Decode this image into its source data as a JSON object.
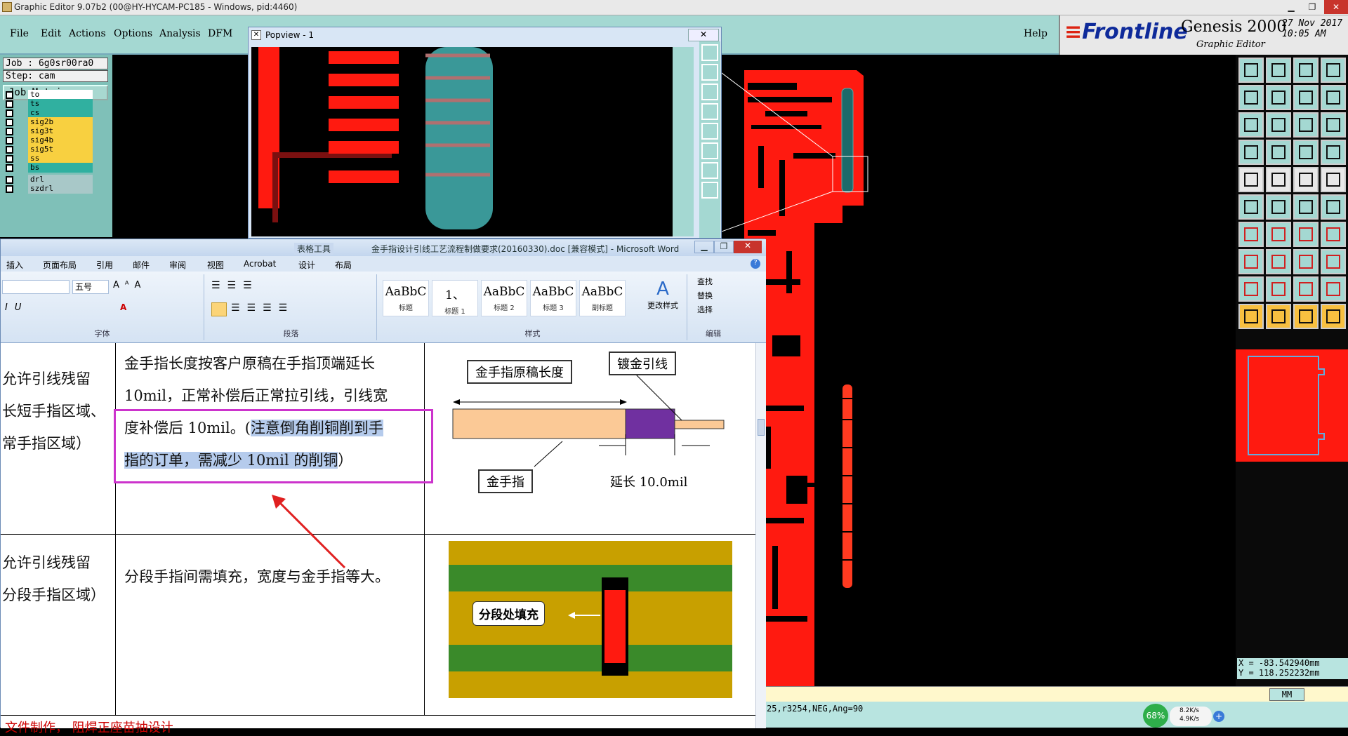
{
  "window": {
    "title": "Graphic Editor 9.07b2 (00@HY-HYCAM-PC185 - Windows, pid:4460)"
  },
  "menu": {
    "items": [
      "File",
      "Edit",
      "Actions",
      "Options",
      "Analysis",
      "DFM"
    ],
    "help": "Help"
  },
  "brand": {
    "logo": "Frontline",
    "product": "Genesis 2000",
    "subtitle": "Graphic Editor",
    "date": "27 Nov 2017",
    "time": "10:05 AM"
  },
  "job": {
    "job": "Job : 6g0sr00ra0",
    "step": "Step: cam",
    "matrix_button": "Job Matrix ..."
  },
  "layers": [
    {
      "name": "to",
      "color": "#ffffff"
    },
    {
      "name": "ts",
      "color": "#30b0a0"
    },
    {
      "name": "cs",
      "color": "#30b0a0"
    },
    {
      "name": "sig2b",
      "color": "#f8d040"
    },
    {
      "name": "sig3t",
      "color": "#f8d040"
    },
    {
      "name": "sig4b",
      "color": "#f8d040"
    },
    {
      "name": "sig5t",
      "color": "#f8d040"
    },
    {
      "name": "ss",
      "color": "#f8d040"
    },
    {
      "name": "bs",
      "color": "#30b0a0"
    },
    {
      "name": "drl",
      "color": "#a8c8c8"
    },
    {
      "name": "szdrl",
      "color": "#a8c8c8"
    }
  ],
  "popview": {
    "title": "Popview - 1"
  },
  "word": {
    "title": "金手指设计引线工艺流程制做要求(20160330).doc [兼容模式] - Microsoft Word",
    "context_tab": "表格工具",
    "tabs": [
      "插入",
      "页面布局",
      "引用",
      "邮件",
      "审阅",
      "视图",
      "Acrobat",
      "设计",
      "布局"
    ],
    "font_size": "五号",
    "groups": [
      "字体",
      "段落",
      "样式",
      "编辑"
    ],
    "styles": [
      {
        "sample": "AaBbC",
        "name": "标题"
      },
      {
        "sample": "1、",
        "name": "标题 1"
      },
      {
        "sample": "AaBbC",
        "name": "标题 2"
      },
      {
        "sample": "AaBbC",
        "name": "标题 3"
      },
      {
        "sample": "AaBbC",
        "name": "副标题"
      }
    ],
    "change_styles": "更改样式",
    "edit_items": [
      "查找",
      "替换",
      "选择"
    ],
    "row1": {
      "left": [
        "允许引线残留",
        "长短手指区域、",
        "常手指区域）"
      ],
      "mid_plain": "金手指长度按客户原稿在手指顶端延长10mil，正常补偿后正常拉引线，引线宽度补偿后 10mil。",
      "mid_line1": "金手指长度按客户原稿在手指顶端延长",
      "mid_line2": "10mil，正常补偿后正常拉引线，引线宽",
      "mid_line3a": "度补偿后 10mil。(",
      "mid_line3b": "注意倒角削铜削到手",
      "mid_line4": "指的订单，需减少 10mil 的削铜",
      "mid_line4b": "）",
      "fig_label1": "金手指原稿长度",
      "fig_label2": "镀金引线",
      "fig_label3": "金手指",
      "fig_label4": "延长 10.0mil"
    },
    "row2": {
      "left": [
        "允许引线残留",
        "分段手指区域）"
      ],
      "mid": "分段手指间需填充，宽度与金手指等大。",
      "fig_label": "分段处填充"
    },
    "bottom_text": "文件制作，   阻焊正座苗抽设计"
  },
  "coords": {
    "x": "X = -83.542940mm",
    "y": "Y = 118.252232mm"
  },
  "status": {
    "text": "25,r3254,NEG,Ang=90",
    "units": "MM"
  },
  "network": {
    "percent": "68%",
    "up": "8.2K/s",
    "down": "4.9K/s"
  },
  "colors": {
    "pcb_red": "#ff1a10",
    "teal": "#a4d8d2",
    "select_box": "#cc33cc",
    "arrow": "#e02020"
  }
}
